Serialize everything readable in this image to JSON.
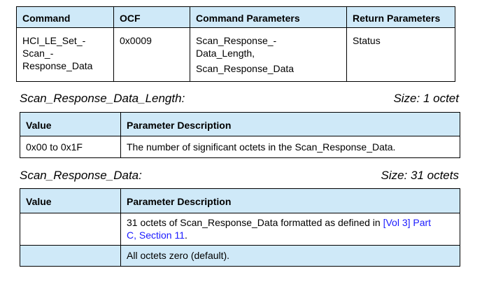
{
  "command_table": {
    "headers": [
      "Command",
      "OCF",
      "Command Parameters",
      "Return Parameters"
    ],
    "command_lines": [
      "HCI_LE_Set_-",
      "Scan_-",
      "Response_Data"
    ],
    "ocf": "0x0009",
    "command_params_lines": [
      "Scan_Response_-",
      "Data_Length,",
      "Scan_Response_Data"
    ],
    "return_params": "Status"
  },
  "length_section": {
    "title": "Scan_Response_Data_Length:",
    "size": "Size: 1 octet",
    "headers": [
      "Value",
      "Parameter Description"
    ],
    "rows": [
      {
        "value": "0x00 to 0x1F",
        "description": "The number of significant octets in the Scan_Response_Data."
      }
    ]
  },
  "data_section": {
    "title": "Scan_Response_Data:",
    "size": "Size: 31 octets",
    "headers": [
      "Value",
      "Parameter Description"
    ],
    "row1_text": "31 octets of Scan_Response_Data formatted as defined in ",
    "row1_link": "[Vol 3] Part",
    "row1_link_line2": "C, Section 11",
    "row1_end": ".",
    "row2_text": "All octets zero (default)."
  },
  "colors": {
    "header_fill": "#cfe9f8",
    "link": "#1a1aff"
  }
}
